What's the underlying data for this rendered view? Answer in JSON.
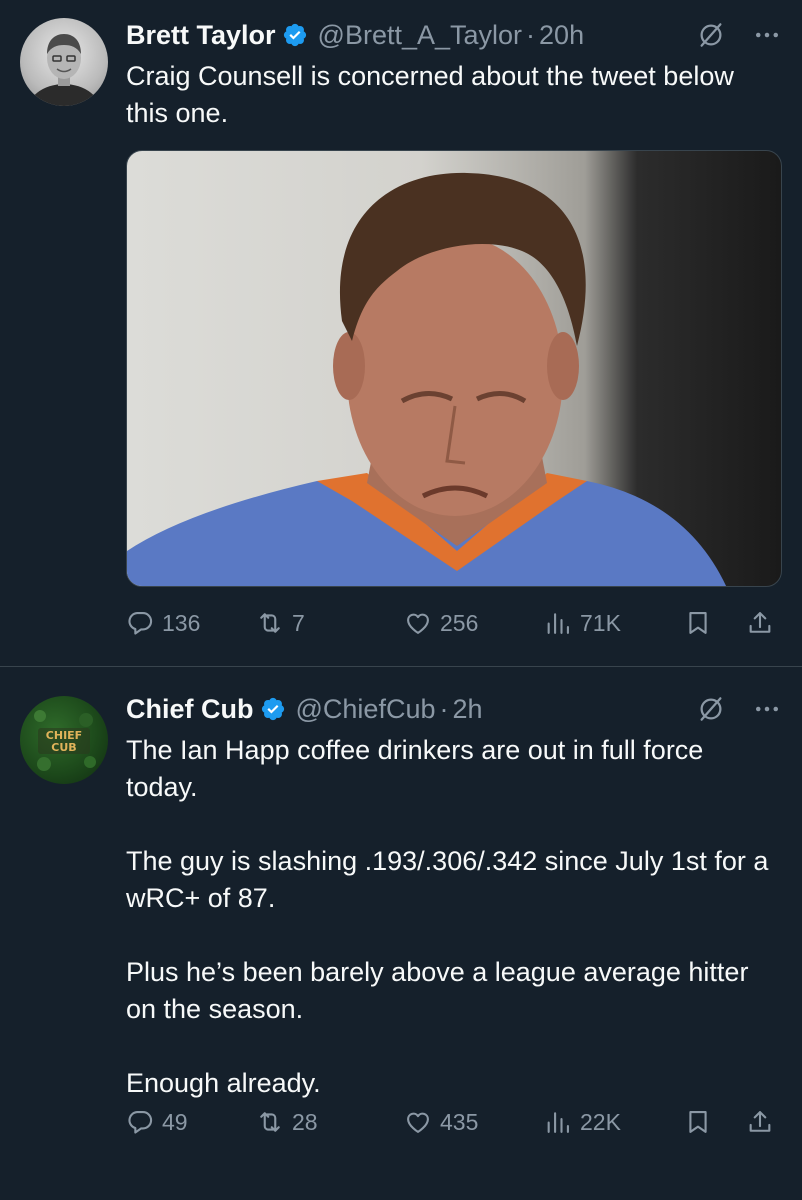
{
  "tweets": [
    {
      "name": "Brett Taylor",
      "handle": "@Brett_A_Taylor",
      "separator": "·",
      "time": "20h",
      "paragraphs": [
        "Craig Counsell is concerned about the tweet below this one."
      ],
      "has_media": true,
      "stats": {
        "replies": "136",
        "retweets": "7",
        "likes": "256",
        "views": "71K"
      }
    },
    {
      "name": "Chief Cub",
      "handle": "@ChiefCub",
      "separator": "·",
      "time": "2h",
      "avatar_text": "CHIEF CUB",
      "paragraphs": [
        "The Ian Happ coffee drinkers are out in full force today.",
        "The guy is slashing .193/.306/.342 since July 1st for a wRC+ of 87.",
        "Plus he’s been barely above a league average hitter on the season.",
        "Enough already."
      ],
      "has_media": false,
      "stats": {
        "replies": "49",
        "retweets": "28",
        "likes": "435",
        "views": "22K"
      }
    }
  ],
  "icons": {
    "verified": "verified-badge-icon",
    "grok": "grok-icon",
    "more": "more-icon",
    "reply": "reply-icon",
    "retweet": "retweet-icon",
    "like": "like-icon",
    "views": "views-icon",
    "bookmark": "bookmark-icon",
    "share": "share-icon"
  },
  "colors": {
    "background": "#15202b",
    "verified": "#1d9bf0",
    "secondary_text": "#8b98a5",
    "divider": "#38444d"
  }
}
